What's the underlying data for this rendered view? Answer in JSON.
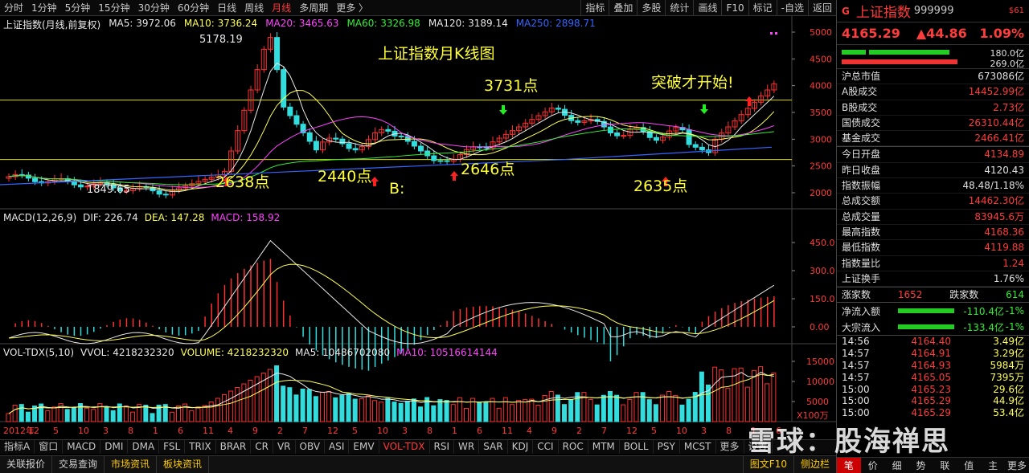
{
  "toolbar": {
    "tabs": [
      "分时",
      "1分钟",
      "5分钟",
      "15分钟",
      "30分钟",
      "60分钟",
      "日线",
      "周线",
      "月线",
      "多周期",
      "更多 〉"
    ],
    "active_tab": "月线",
    "tools": [
      "指标",
      "叠加",
      "多股",
      "统计",
      "画线",
      "F10",
      "标记",
      "-自选",
      "返回"
    ]
  },
  "kline": {
    "title": "上证指数(月线,前复权)",
    "ma5": "MA5: 3972.06",
    "ma10": "MA10: 3736.24",
    "ma20": "MA20: 3465.63",
    "ma60": "MA60: 3326.98",
    "ma120": "MA120: 3189.14",
    "ma250": "MA250: 2898.71",
    "y_ticks": [
      "5000",
      "4500",
      "4000",
      "3500",
      "3000",
      "2500",
      "2000"
    ],
    "high_label": "5178.19",
    "low_label": "1849.65",
    "annotations": {
      "title": "上证指数月K线图",
      "p3731": "3731点",
      "breakout": "突破才开始!",
      "p2638": "2638点",
      "p2440": "2440点",
      "p2646": "2646点",
      "p2635": "2635点",
      "b_label": "B:"
    }
  },
  "macd": {
    "title": "MACD(12,26,9)",
    "dif": "DIF: 226.74",
    "dea": "DEA: 147.28",
    "macd": "MACD: 158.92",
    "y_ticks": [
      "450.0",
      "300.0",
      "150.0",
      "0.00"
    ]
  },
  "vol": {
    "title": "VOL-TDX(5,10)",
    "vvol": "VVOL: 4218232320",
    "volume": "VOLUME: 4218232320",
    "ma5": "MA5: 10486702080",
    "ma10": "MA10: 10516614144",
    "y_ticks": [
      "15000",
      "10000",
      "5000"
    ],
    "unit": "X100万",
    "x_labels": [
      "2012年",
      "12",
      "5",
      "10",
      "3",
      "8",
      "1",
      "6",
      "11",
      "4",
      "9",
      "2",
      "7",
      "12",
      "5",
      "10",
      "3",
      "8",
      "1",
      "6",
      "11",
      "4",
      "9",
      "2",
      "7",
      "12",
      "5",
      "10",
      "3",
      "8",
      "1",
      "6"
    ]
  },
  "indicators": [
    "指标A",
    "窗口",
    "MACD",
    "DMI",
    "DMA",
    "FSL",
    "TRIX",
    "BRAR",
    "CR",
    "VR",
    "OBV",
    "ASI",
    "EMV",
    "VOL-TDX",
    "RSI",
    "WR",
    "SAR",
    "KDJ",
    "CCI",
    "ROC",
    "MTM",
    "BOLL",
    "PSY",
    "MCST",
    "更多",
    "设置"
  ],
  "active_indicator": "VOL-TDX",
  "bottom": {
    "items": [
      "关联报价",
      "交易查询",
      "市场资讯",
      "板块资讯"
    ],
    "right": [
      "图文F10",
      "侧边栏"
    ]
  },
  "panel": {
    "g": "G",
    "name": "上证指数",
    "code": "999999",
    "badge": "$61",
    "price": "4165.29",
    "change": "▲44.86",
    "pct": "1.09%",
    "bar_val1": "180.0亿",
    "bar_val2": "269.0亿",
    "stats": [
      {
        "label": "沪总市值",
        "value": "673086亿",
        "color": ""
      },
      {
        "label": "A股成交",
        "value": "14452.99亿",
        "color": "red"
      },
      {
        "label": "B股成交",
        "value": "2.73亿",
        "color": "red"
      },
      {
        "label": "国债成交",
        "value": "26310.44亿",
        "color": "red"
      },
      {
        "label": "基金成交",
        "value": "2466.41亿",
        "color": "red"
      }
    ],
    "stats2": [
      {
        "label": "今日开盘",
        "value": "4134.89",
        "color": "red"
      },
      {
        "label": "昨日收盘",
        "value": "4120.43",
        "color": ""
      },
      {
        "label": "指数振幅",
        "value": "48.48/1.18%",
        "color": ""
      },
      {
        "label": "总成交额",
        "value": "14462.30亿",
        "color": "red"
      },
      {
        "label": "总成交量",
        "value": "83945.6万",
        "color": "red"
      },
      {
        "label": "最高指数",
        "value": "4168.36",
        "color": "red"
      },
      {
        "label": "最低指数",
        "value": "4119.88",
        "color": "red"
      },
      {
        "label": "指数量比",
        "value": "1.24",
        "color": "red"
      },
      {
        "label": "上证换手",
        "value": "1.76%",
        "color": ""
      }
    ],
    "updown": {
      "up_label": "涨家数",
      "up": "1652",
      "down_label": "跌家数",
      "down": "614"
    },
    "flows": [
      {
        "label": "净流入额",
        "value": "-110.4亿",
        "pct": "-1%"
      },
      {
        "label": "大宗流入",
        "value": "-133.4亿",
        "pct": "-1%"
      }
    ],
    "ticks": [
      {
        "t": "14:56",
        "p": "4164.40",
        "v": "3.49亿"
      },
      {
        "t": "14:57",
        "p": "4164.91",
        "v": "3.29亿"
      },
      {
        "t": "14:57",
        "p": "4164.93",
        "v": "5984万"
      },
      {
        "t": "14:57",
        "p": "4165.05",
        "v": "7395万"
      },
      {
        "t": "15:00",
        "p": "4165.23",
        "v": "29.6亿"
      },
      {
        "t": "15:00",
        "p": "4165.29",
        "v": "44.9亿"
      },
      {
        "t": "15:00",
        "p": "4165.29",
        "v": "53.4亿"
      }
    ],
    "nav": [
      "笔",
      "价",
      "细",
      "势",
      "联",
      "值",
      "主",
      "更多"
    ],
    "nav_active": "笔"
  },
  "watermark": "雪球：股海禅思"
}
